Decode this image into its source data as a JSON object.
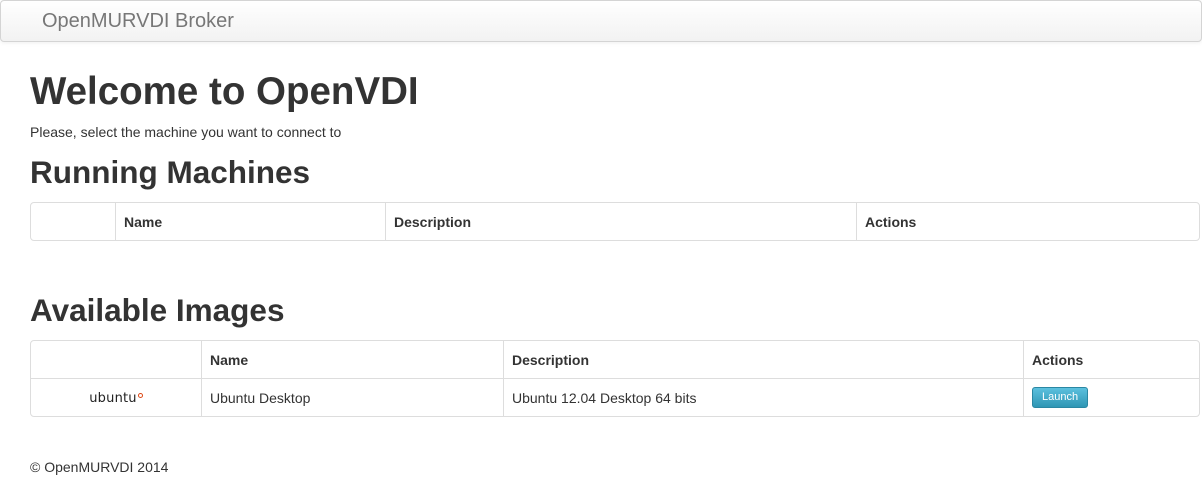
{
  "navbar": {
    "brand": "OpenMURVDI Broker"
  },
  "main": {
    "title": "Welcome to OpenVDI",
    "subtitle": "Please, select the machine you want to connect to"
  },
  "running_machines": {
    "heading": "Running Machines",
    "columns": [
      "",
      "Name",
      "Description",
      "Actions"
    ],
    "rows": []
  },
  "available_images": {
    "heading": "Available Images",
    "columns": [
      "",
      "Name",
      "Description",
      "Actions"
    ],
    "rows": [
      {
        "logo_text": "ubuntu",
        "name": "Ubuntu Desktop",
        "description": "Ubuntu 12.04 Desktop 64 bits",
        "action_label": "Launch"
      }
    ]
  },
  "footer": {
    "text": "© OpenMURVDI 2014"
  },
  "colors": {
    "launch_button": "#49afcd",
    "ubuntu_accent": "#dd4814"
  }
}
